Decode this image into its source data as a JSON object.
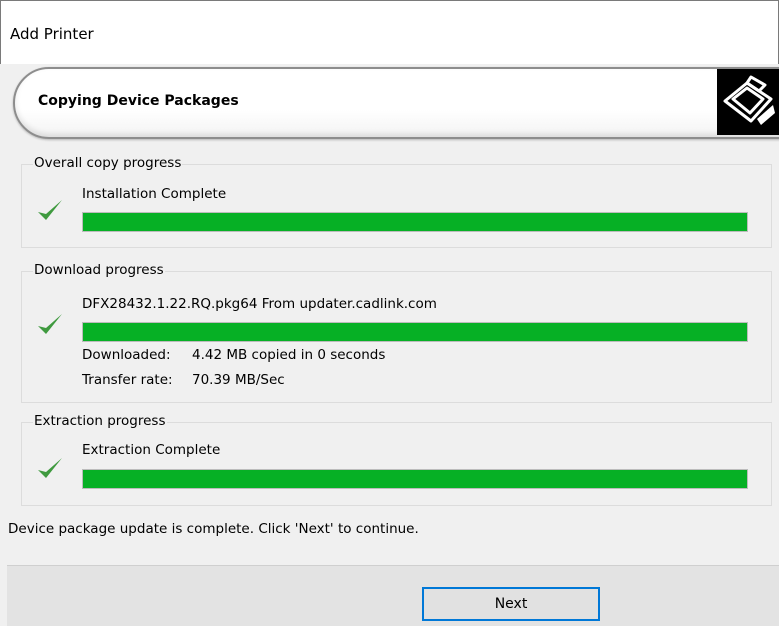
{
  "window": {
    "title": "Add Printer"
  },
  "banner": {
    "heading": "Copying Device Packages"
  },
  "overall": {
    "legend": "Overall copy progress",
    "status": "Installation Complete",
    "progress": 1.0
  },
  "download": {
    "legend": "Download progress",
    "status": "DFX28432.1.22.RQ.pkg64 From updater.cadlink.com",
    "progress": 1.0,
    "downloaded_label": "Downloaded:",
    "downloaded_value": "4.42 MB copied in 0 seconds",
    "rate_label": "Transfer rate:",
    "rate_value": "70.39 MB/Sec"
  },
  "extraction": {
    "legend": "Extraction progress",
    "status": "Extraction Complete",
    "progress": 1.0
  },
  "status_message": "Device package update is complete. Click 'Next' to continue.",
  "buttons": {
    "next_label": "Next"
  },
  "colors": {
    "progress_fill": "#06b025",
    "check": "#3f9a3f",
    "button_border": "#0078d7"
  },
  "icons": {
    "check": "checkmark-icon",
    "printer": "printer-icon"
  }
}
